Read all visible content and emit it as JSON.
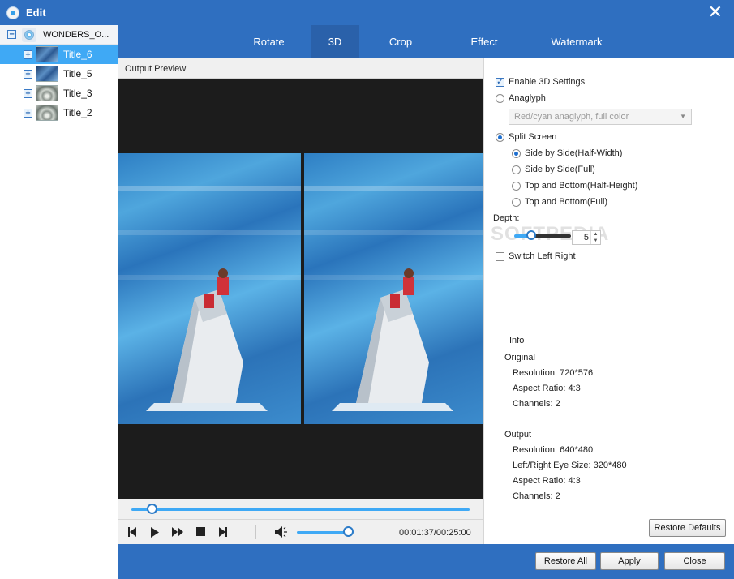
{
  "window": {
    "title": "Edit",
    "close_glyph": "✕"
  },
  "tree": {
    "root_label": "WONDERS_O...",
    "items": [
      {
        "label": "Title_6",
        "selected": true,
        "thumb": "sea"
      },
      {
        "label": "Title_5",
        "selected": false,
        "thumb": "sea"
      },
      {
        "label": "Title_3",
        "selected": false,
        "thumb": "drop"
      },
      {
        "label": "Title_2",
        "selected": false,
        "thumb": "drop"
      }
    ],
    "expander_glyph": "+",
    "root_expander_glyph": "−"
  },
  "tabs": [
    {
      "label": "Rotate",
      "active": false
    },
    {
      "label": "3D",
      "active": true
    },
    {
      "label": "Crop",
      "active": false
    },
    {
      "label": "Effect",
      "active": false
    },
    {
      "label": "Watermark",
      "active": false
    }
  ],
  "preview": {
    "header": "Output Preview",
    "seek_fraction": 0.06,
    "volume_fraction": 0.9,
    "time": "00:01:37/00:25:00"
  },
  "settings3d": {
    "enable_label": "Enable 3D Settings",
    "enable_checked": true,
    "anaglyph_label": "Anaglyph",
    "anaglyph_option": "Red/cyan anaglyph, full color",
    "split_label": "Split Screen",
    "split_options": [
      "Side by Side(Half-Width)",
      "Side by Side(Full)",
      "Top and Bottom(Half-Height)",
      "Top and Bottom(Full)"
    ],
    "split_selected_index": 0,
    "depth_label": "Depth:",
    "depth_value": "5",
    "switch_label": "Switch Left Right",
    "switch_checked": false
  },
  "watermark_text": "SOFTPEDIA",
  "info": {
    "legend": "Info",
    "original_label": "Original",
    "original": [
      "Resolution: 720*576",
      "Aspect Ratio: 4:3",
      "Channels: 2"
    ],
    "output_label": "Output",
    "output": [
      "Resolution: 640*480",
      "Left/Right Eye Size: 320*480",
      "Aspect Ratio: 4:3",
      "Channels: 2"
    ]
  },
  "buttons": {
    "restore_defaults": "Restore Defaults",
    "restore_all": "Restore All",
    "apply": "Apply",
    "close": "Close"
  },
  "colors": {
    "accent": "#2f6fc0",
    "selection": "#3fa9f5",
    "active_tab": "#2a61aa"
  }
}
